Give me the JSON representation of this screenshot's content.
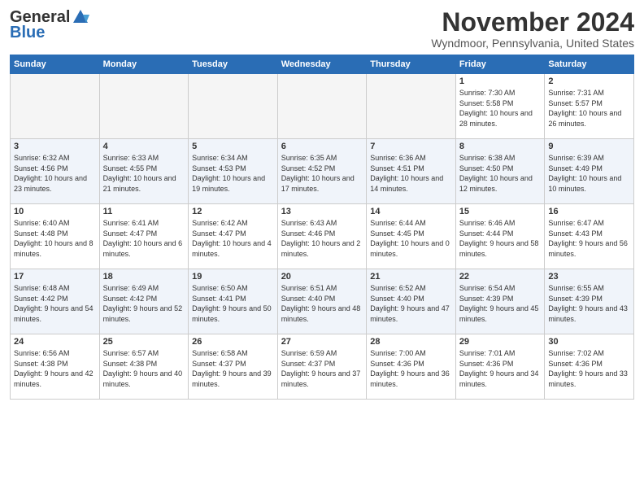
{
  "logo": {
    "line1": "General",
    "line2": "Blue"
  },
  "header": {
    "month_year": "November 2024",
    "location": "Wyndmoor, Pennsylvania, United States"
  },
  "days_of_week": [
    "Sunday",
    "Monday",
    "Tuesday",
    "Wednesday",
    "Thursday",
    "Friday",
    "Saturday"
  ],
  "weeks": [
    {
      "shade": false,
      "days": [
        {
          "num": "",
          "empty": true,
          "sunrise": "",
          "sunset": "",
          "daylight": ""
        },
        {
          "num": "",
          "empty": true,
          "sunrise": "",
          "sunset": "",
          "daylight": ""
        },
        {
          "num": "",
          "empty": true,
          "sunrise": "",
          "sunset": "",
          "daylight": ""
        },
        {
          "num": "",
          "empty": true,
          "sunrise": "",
          "sunset": "",
          "daylight": ""
        },
        {
          "num": "",
          "empty": true,
          "sunrise": "",
          "sunset": "",
          "daylight": ""
        },
        {
          "num": "1",
          "empty": false,
          "sunrise": "Sunrise: 7:30 AM",
          "sunset": "Sunset: 5:58 PM",
          "daylight": "Daylight: 10 hours and 28 minutes."
        },
        {
          "num": "2",
          "empty": false,
          "sunrise": "Sunrise: 7:31 AM",
          "sunset": "Sunset: 5:57 PM",
          "daylight": "Daylight: 10 hours and 26 minutes."
        }
      ]
    },
    {
      "shade": true,
      "days": [
        {
          "num": "3",
          "empty": false,
          "sunrise": "Sunrise: 6:32 AM",
          "sunset": "Sunset: 4:56 PM",
          "daylight": "Daylight: 10 hours and 23 minutes."
        },
        {
          "num": "4",
          "empty": false,
          "sunrise": "Sunrise: 6:33 AM",
          "sunset": "Sunset: 4:55 PM",
          "daylight": "Daylight: 10 hours and 21 minutes."
        },
        {
          "num": "5",
          "empty": false,
          "sunrise": "Sunrise: 6:34 AM",
          "sunset": "Sunset: 4:53 PM",
          "daylight": "Daylight: 10 hours and 19 minutes."
        },
        {
          "num": "6",
          "empty": false,
          "sunrise": "Sunrise: 6:35 AM",
          "sunset": "Sunset: 4:52 PM",
          "daylight": "Daylight: 10 hours and 17 minutes."
        },
        {
          "num": "7",
          "empty": false,
          "sunrise": "Sunrise: 6:36 AM",
          "sunset": "Sunset: 4:51 PM",
          "daylight": "Daylight: 10 hours and 14 minutes."
        },
        {
          "num": "8",
          "empty": false,
          "sunrise": "Sunrise: 6:38 AM",
          "sunset": "Sunset: 4:50 PM",
          "daylight": "Daylight: 10 hours and 12 minutes."
        },
        {
          "num": "9",
          "empty": false,
          "sunrise": "Sunrise: 6:39 AM",
          "sunset": "Sunset: 4:49 PM",
          "daylight": "Daylight: 10 hours and 10 minutes."
        }
      ]
    },
    {
      "shade": false,
      "days": [
        {
          "num": "10",
          "empty": false,
          "sunrise": "Sunrise: 6:40 AM",
          "sunset": "Sunset: 4:48 PM",
          "daylight": "Daylight: 10 hours and 8 minutes."
        },
        {
          "num": "11",
          "empty": false,
          "sunrise": "Sunrise: 6:41 AM",
          "sunset": "Sunset: 4:47 PM",
          "daylight": "Daylight: 10 hours and 6 minutes."
        },
        {
          "num": "12",
          "empty": false,
          "sunrise": "Sunrise: 6:42 AM",
          "sunset": "Sunset: 4:47 PM",
          "daylight": "Daylight: 10 hours and 4 minutes."
        },
        {
          "num": "13",
          "empty": false,
          "sunrise": "Sunrise: 6:43 AM",
          "sunset": "Sunset: 4:46 PM",
          "daylight": "Daylight: 10 hours and 2 minutes."
        },
        {
          "num": "14",
          "empty": false,
          "sunrise": "Sunrise: 6:44 AM",
          "sunset": "Sunset: 4:45 PM",
          "daylight": "Daylight: 10 hours and 0 minutes."
        },
        {
          "num": "15",
          "empty": false,
          "sunrise": "Sunrise: 6:46 AM",
          "sunset": "Sunset: 4:44 PM",
          "daylight": "Daylight: 9 hours and 58 minutes."
        },
        {
          "num": "16",
          "empty": false,
          "sunrise": "Sunrise: 6:47 AM",
          "sunset": "Sunset: 4:43 PM",
          "daylight": "Daylight: 9 hours and 56 minutes."
        }
      ]
    },
    {
      "shade": true,
      "days": [
        {
          "num": "17",
          "empty": false,
          "sunrise": "Sunrise: 6:48 AM",
          "sunset": "Sunset: 4:42 PM",
          "daylight": "Daylight: 9 hours and 54 minutes."
        },
        {
          "num": "18",
          "empty": false,
          "sunrise": "Sunrise: 6:49 AM",
          "sunset": "Sunset: 4:42 PM",
          "daylight": "Daylight: 9 hours and 52 minutes."
        },
        {
          "num": "19",
          "empty": false,
          "sunrise": "Sunrise: 6:50 AM",
          "sunset": "Sunset: 4:41 PM",
          "daylight": "Daylight: 9 hours and 50 minutes."
        },
        {
          "num": "20",
          "empty": false,
          "sunrise": "Sunrise: 6:51 AM",
          "sunset": "Sunset: 4:40 PM",
          "daylight": "Daylight: 9 hours and 48 minutes."
        },
        {
          "num": "21",
          "empty": false,
          "sunrise": "Sunrise: 6:52 AM",
          "sunset": "Sunset: 4:40 PM",
          "daylight": "Daylight: 9 hours and 47 minutes."
        },
        {
          "num": "22",
          "empty": false,
          "sunrise": "Sunrise: 6:54 AM",
          "sunset": "Sunset: 4:39 PM",
          "daylight": "Daylight: 9 hours and 45 minutes."
        },
        {
          "num": "23",
          "empty": false,
          "sunrise": "Sunrise: 6:55 AM",
          "sunset": "Sunset: 4:39 PM",
          "daylight": "Daylight: 9 hours and 43 minutes."
        }
      ]
    },
    {
      "shade": false,
      "days": [
        {
          "num": "24",
          "empty": false,
          "sunrise": "Sunrise: 6:56 AM",
          "sunset": "Sunset: 4:38 PM",
          "daylight": "Daylight: 9 hours and 42 minutes."
        },
        {
          "num": "25",
          "empty": false,
          "sunrise": "Sunrise: 6:57 AM",
          "sunset": "Sunset: 4:38 PM",
          "daylight": "Daylight: 9 hours and 40 minutes."
        },
        {
          "num": "26",
          "empty": false,
          "sunrise": "Sunrise: 6:58 AM",
          "sunset": "Sunset: 4:37 PM",
          "daylight": "Daylight: 9 hours and 39 minutes."
        },
        {
          "num": "27",
          "empty": false,
          "sunrise": "Sunrise: 6:59 AM",
          "sunset": "Sunset: 4:37 PM",
          "daylight": "Daylight: 9 hours and 37 minutes."
        },
        {
          "num": "28",
          "empty": false,
          "sunrise": "Sunrise: 7:00 AM",
          "sunset": "Sunset: 4:36 PM",
          "daylight": "Daylight: 9 hours and 36 minutes."
        },
        {
          "num": "29",
          "empty": false,
          "sunrise": "Sunrise: 7:01 AM",
          "sunset": "Sunset: 4:36 PM",
          "daylight": "Daylight: 9 hours and 34 minutes."
        },
        {
          "num": "30",
          "empty": false,
          "sunrise": "Sunrise: 7:02 AM",
          "sunset": "Sunset: 4:36 PM",
          "daylight": "Daylight: 9 hours and 33 minutes."
        }
      ]
    }
  ]
}
